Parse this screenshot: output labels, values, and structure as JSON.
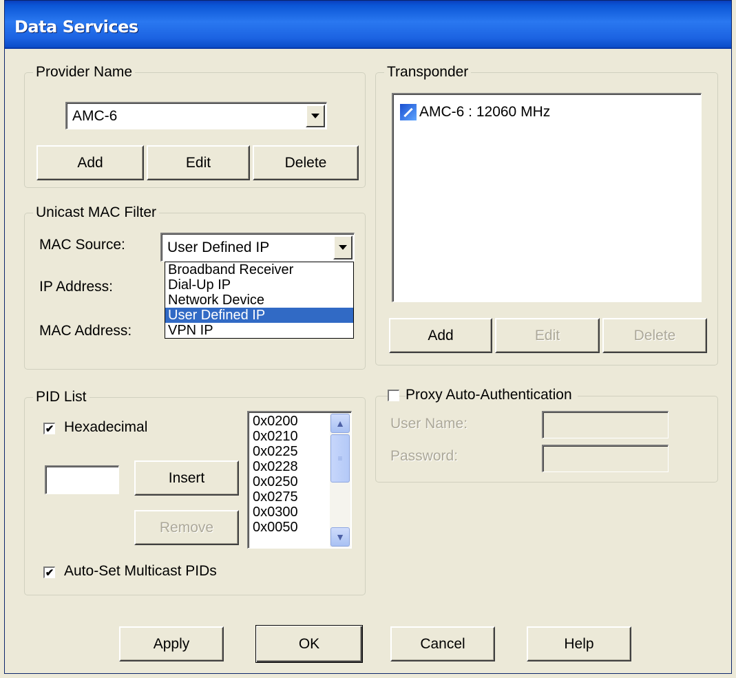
{
  "window": {
    "title": "Data Services"
  },
  "provider": {
    "legend": "Provider Name",
    "selected": "AMC-6",
    "buttons": {
      "add": "Add",
      "edit": "Edit",
      "delete": "Delete"
    }
  },
  "transponder": {
    "legend": "Transponder",
    "items": [
      "AMC-6 : 12060 MHz"
    ],
    "buttons": {
      "add": "Add",
      "edit": "Edit",
      "delete": "Delete"
    }
  },
  "mac_filter": {
    "legend": "Unicast MAC Filter",
    "mac_source_label": "MAC Source:",
    "mac_source_value": "User Defined IP",
    "ip_label": "IP Address:",
    "mac_label": "MAC Address:",
    "options": [
      "Broadband Receiver",
      "Dial-Up IP",
      "Network Device",
      "User Defined IP",
      "VPN IP"
    ]
  },
  "pid_list": {
    "legend": "PID List",
    "hex_label": "Hexadecimal",
    "hex_checked": "✔",
    "insert": "Insert",
    "remove": "Remove",
    "auto_set_label": "Auto-Set Multicast PIDs",
    "auto_set_checked": "✔",
    "pids": [
      "0x0200",
      "0x0210",
      "0x0225",
      "0x0228",
      "0x0250",
      "0x0275",
      "0x0300",
      "0x0050"
    ]
  },
  "proxy": {
    "label": "Proxy Auto-Authentication",
    "user_label": "User Name:",
    "password_label": "Password:"
  },
  "footer": {
    "apply": "Apply",
    "ok": "OK",
    "cancel": "Cancel",
    "help": "Help"
  }
}
